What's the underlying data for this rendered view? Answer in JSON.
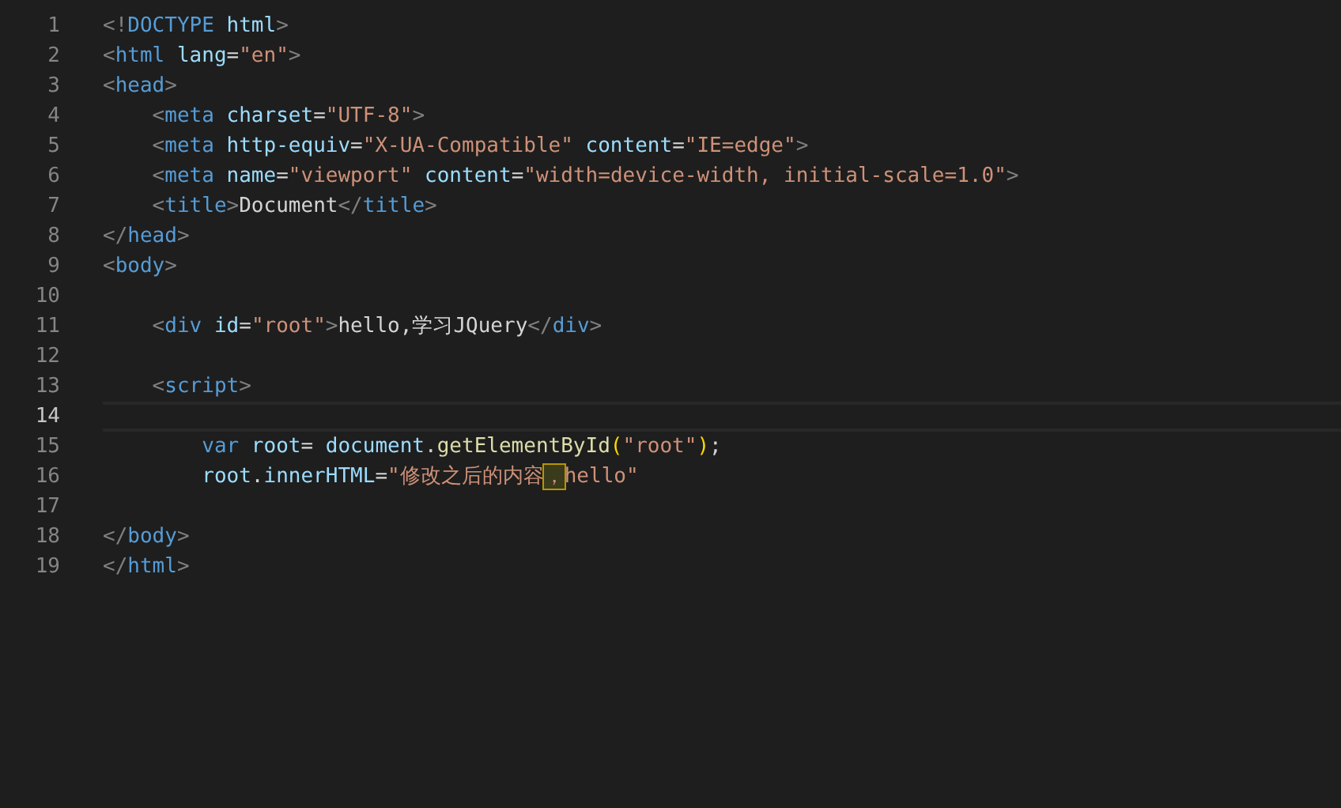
{
  "editor": {
    "lines": [
      {
        "number": "1",
        "active": false,
        "tokens": [
          {
            "kind": "punct",
            "text": "<!"
          },
          {
            "kind": "tag",
            "text": "DOCTYPE"
          },
          {
            "kind": "attr",
            "text": " html"
          },
          {
            "kind": "punct",
            "text": ">"
          }
        ]
      },
      {
        "number": "2",
        "active": false,
        "tokens": [
          {
            "kind": "punct",
            "text": "<"
          },
          {
            "kind": "tag",
            "text": "html"
          },
          {
            "kind": "attr",
            "text": " lang"
          },
          {
            "kind": "text",
            "text": "="
          },
          {
            "kind": "string",
            "text": "\"en\""
          },
          {
            "kind": "punct",
            "text": ">"
          }
        ]
      },
      {
        "number": "3",
        "active": false,
        "tokens": [
          {
            "kind": "punct",
            "text": "<"
          },
          {
            "kind": "tag",
            "text": "head"
          },
          {
            "kind": "punct",
            "text": ">"
          }
        ]
      },
      {
        "number": "4",
        "active": false,
        "tokens": [
          {
            "kind": "punct",
            "text": "    <"
          },
          {
            "kind": "tag",
            "text": "meta"
          },
          {
            "kind": "attr",
            "text": " charset"
          },
          {
            "kind": "text",
            "text": "="
          },
          {
            "kind": "string",
            "text": "\"UTF-8\""
          },
          {
            "kind": "punct",
            "text": ">"
          }
        ]
      },
      {
        "number": "5",
        "active": false,
        "tokens": [
          {
            "kind": "punct",
            "text": "    <"
          },
          {
            "kind": "tag",
            "text": "meta"
          },
          {
            "kind": "attr",
            "text": " http-equiv"
          },
          {
            "kind": "text",
            "text": "="
          },
          {
            "kind": "string",
            "text": "\"X-UA-Compatible\""
          },
          {
            "kind": "attr",
            "text": " content"
          },
          {
            "kind": "text",
            "text": "="
          },
          {
            "kind": "string",
            "text": "\"IE=edge\""
          },
          {
            "kind": "punct",
            "text": ">"
          }
        ]
      },
      {
        "number": "6",
        "active": false,
        "tokens": [
          {
            "kind": "punct",
            "text": "    <"
          },
          {
            "kind": "tag",
            "text": "meta"
          },
          {
            "kind": "attr",
            "text": " name"
          },
          {
            "kind": "text",
            "text": "="
          },
          {
            "kind": "string",
            "text": "\"viewport\""
          },
          {
            "kind": "attr",
            "text": " content"
          },
          {
            "kind": "text",
            "text": "="
          },
          {
            "kind": "string",
            "text": "\"width=device-width, initial-scale=1.0\""
          },
          {
            "kind": "punct",
            "text": ">"
          }
        ]
      },
      {
        "number": "7",
        "active": false,
        "tokens": [
          {
            "kind": "punct",
            "text": "    <"
          },
          {
            "kind": "tag",
            "text": "title"
          },
          {
            "kind": "punct",
            "text": ">"
          },
          {
            "kind": "text",
            "text": "Document"
          },
          {
            "kind": "punct",
            "text": "</"
          },
          {
            "kind": "tag",
            "text": "title"
          },
          {
            "kind": "punct",
            "text": ">"
          }
        ]
      },
      {
        "number": "8",
        "active": false,
        "tokens": [
          {
            "kind": "punct",
            "text": "</"
          },
          {
            "kind": "tag",
            "text": "head"
          },
          {
            "kind": "punct",
            "text": ">"
          }
        ]
      },
      {
        "number": "9",
        "active": false,
        "tokens": [
          {
            "kind": "punct",
            "text": "<"
          },
          {
            "kind": "tag",
            "text": "body"
          },
          {
            "kind": "punct",
            "text": ">"
          }
        ]
      },
      {
        "number": "10",
        "active": false
      },
      {
        "number": "11",
        "active": false,
        "tokens": [
          {
            "kind": "punct",
            "text": "    <"
          },
          {
            "kind": "tag",
            "text": "div"
          },
          {
            "kind": "attr",
            "text": " id"
          },
          {
            "kind": "text",
            "text": "="
          },
          {
            "kind": "string",
            "text": "\"root\""
          },
          {
            "kind": "punct",
            "text": ">"
          },
          {
            "kind": "text",
            "text": "hello,学习JQuery"
          },
          {
            "kind": "punct",
            "text": "</"
          },
          {
            "kind": "tag",
            "text": "div"
          },
          {
            "kind": "punct",
            "text": ">"
          }
        ]
      },
      {
        "number": "12",
        "active": false
      },
      {
        "number": "13",
        "active": false,
        "tokens": [
          {
            "kind": "punct",
            "text": "    <"
          },
          {
            "kind": "tag",
            "text": "script"
          },
          {
            "kind": "punct",
            "text": ">"
          }
        ]
      },
      {
        "number": "14",
        "active": true
      },
      {
        "number": "15",
        "active": false,
        "tokens": [
          {
            "kind": "keyword",
            "text": "        var"
          },
          {
            "kind": "variable",
            "text": " root"
          },
          {
            "kind": "text",
            "text": "= "
          },
          {
            "kind": "variable",
            "text": "document"
          },
          {
            "kind": "text",
            "text": "."
          },
          {
            "kind": "function",
            "text": "getElementById"
          },
          {
            "kind": "paren",
            "text": "("
          },
          {
            "kind": "string",
            "text": "\"root\""
          },
          {
            "kind": "paren",
            "text": ")"
          },
          {
            "kind": "text",
            "text": ";"
          }
        ]
      },
      {
        "number": "16",
        "active": false,
        "tokens": [
          {
            "kind": "variable",
            "text": "        root"
          },
          {
            "kind": "text",
            "text": "."
          },
          {
            "kind": "variable",
            "text": "innerHTML"
          },
          {
            "kind": "text",
            "text": "="
          },
          {
            "kind": "string",
            "text": "\"修改之后的内容"
          },
          {
            "kind": "match",
            "text": "，"
          },
          {
            "kind": "string",
            "text": "hello\""
          }
        ]
      },
      {
        "number": "17",
        "active": false
      },
      {
        "number": "18",
        "active": false,
        "tokens": [
          {
            "kind": "punct",
            "text": "</"
          },
          {
            "kind": "tag",
            "text": "body"
          },
          {
            "kind": "punct",
            "text": ">"
          }
        ]
      },
      {
        "number": "19",
        "active": false,
        "tokens": [
          {
            "kind": "punct",
            "text": "</"
          },
          {
            "kind": "tag",
            "text": "html"
          },
          {
            "kind": "punct",
            "text": ">"
          }
        ]
      }
    ]
  }
}
